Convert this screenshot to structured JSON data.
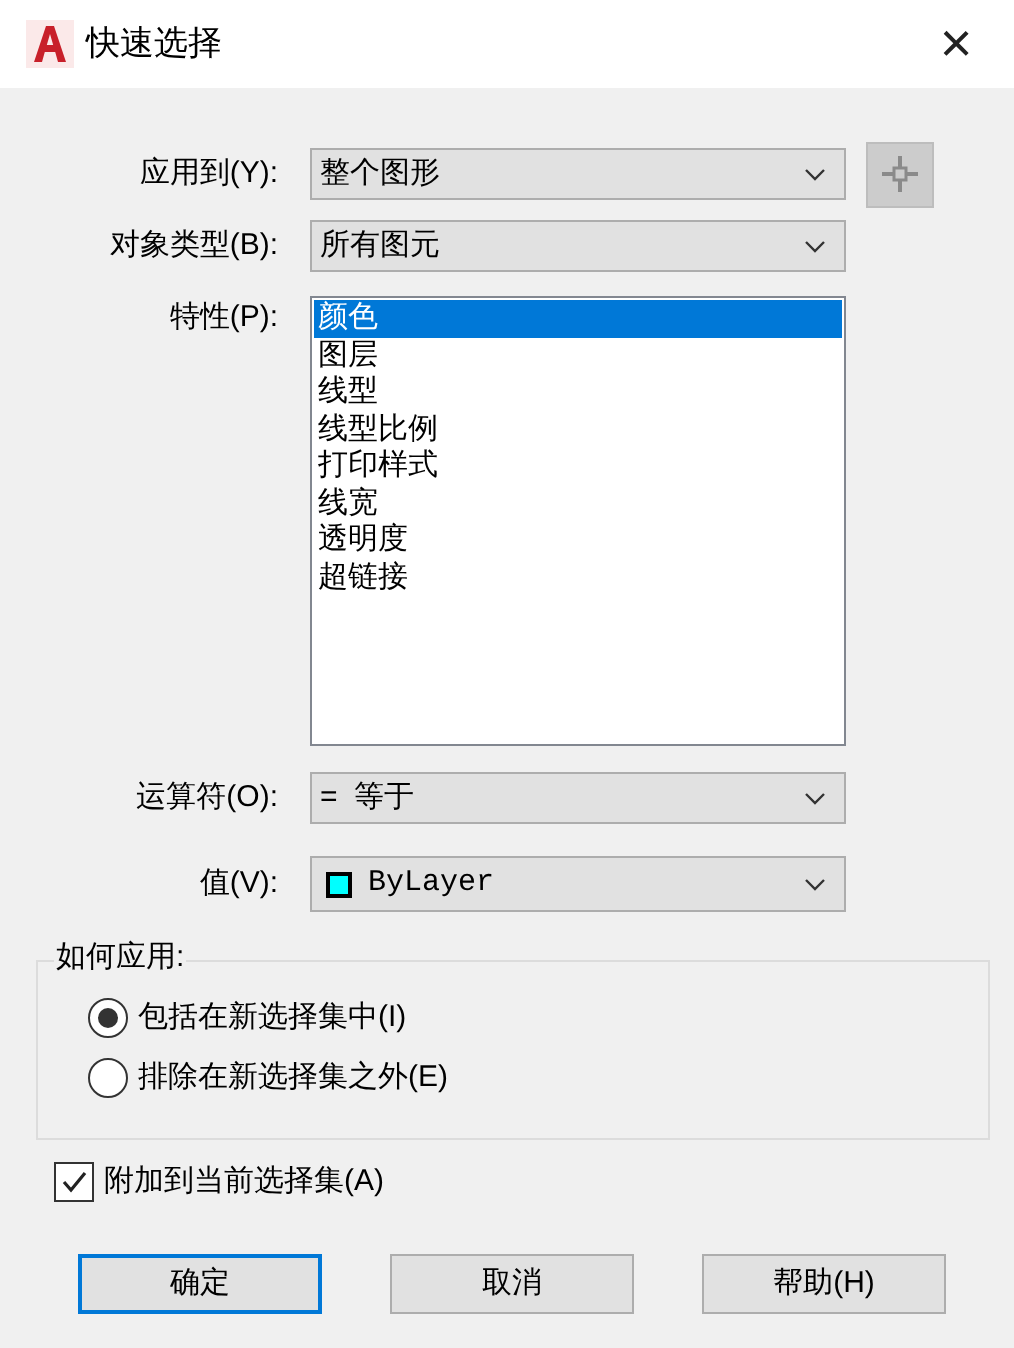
{
  "window": {
    "title": "快速选择",
    "close": "×"
  },
  "fields": [
    {
      "label": "应用到(Y):",
      "value": "整个图形",
      "pick_button": true
    },
    {
      "label": "对象类型(B):",
      "value": "所有图元",
      "pick_button": false
    }
  ],
  "properties": {
    "label": "特性(P):",
    "items": [
      {
        "text": "颜色",
        "selected": true
      },
      {
        "text": "图层",
        "selected": false
      },
      {
        "text": "线型",
        "selected": false
      },
      {
        "text": "线型比例",
        "selected": false
      },
      {
        "text": "打印样式",
        "selected": false
      },
      {
        "text": "线宽",
        "selected": false
      },
      {
        "text": "透明度",
        "selected": false
      },
      {
        "text": "超链接",
        "selected": false
      }
    ]
  },
  "operator": {
    "label": "运算符(O):",
    "value": "=  等于"
  },
  "value": {
    "label": "值(V):",
    "value": "ByLayer",
    "color": "#00ffff"
  },
  "how_to_apply": {
    "legend": "如何应用:",
    "options": [
      {
        "label": "包括在新选择集中(I)",
        "selected": true
      },
      {
        "label": "排除在新选择集之外(E)",
        "selected": false
      }
    ]
  },
  "append": {
    "label": "附加到当前选择集(A)",
    "checked": true
  },
  "buttons": [
    {
      "label": "确定",
      "default": true
    },
    {
      "label": "取消",
      "default": false
    },
    {
      "label": "帮助(H)",
      "default": false
    }
  ]
}
